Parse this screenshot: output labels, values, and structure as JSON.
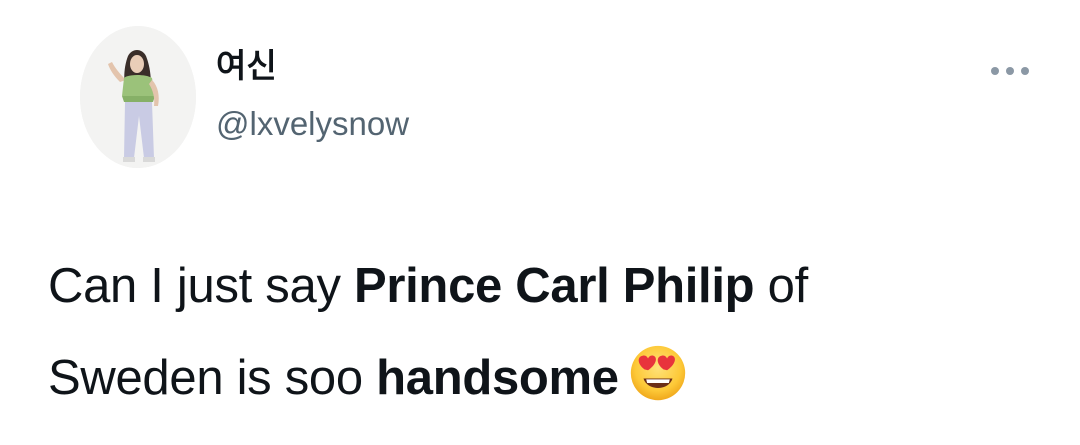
{
  "user": {
    "display_name": "여신",
    "handle": "@lxvelysnow"
  },
  "tweet": {
    "line1_part1": "Can I just say ",
    "line1_bold": "Prince Carl Philip",
    "line1_part2": " of",
    "line2_part1": "Sweden is soo ",
    "line2_bold": "handsome",
    "emoji": "smiling-face-with-heart-eyes"
  },
  "colors": {
    "text": "#0f1419",
    "secondary": "#536471",
    "more_dots": "#8b98a5"
  }
}
